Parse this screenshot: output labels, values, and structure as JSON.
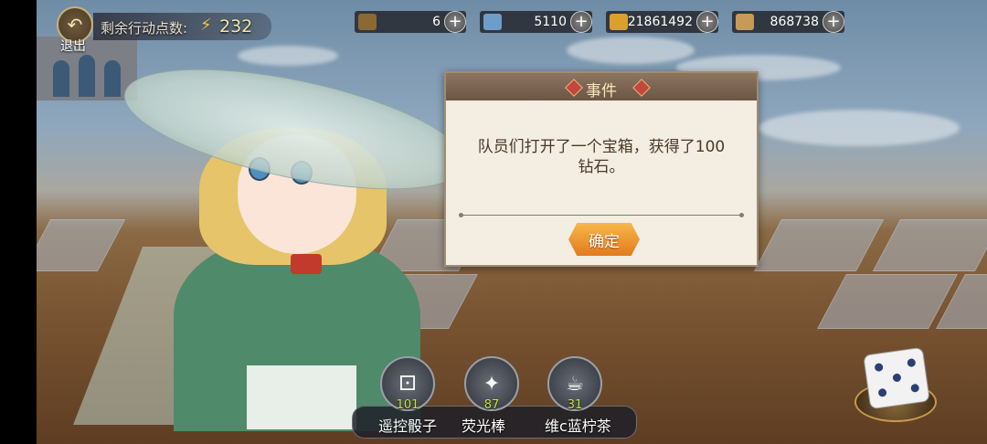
{
  "hud": {
    "exit_label": "退出",
    "action_points_label": "剩余行动点数:",
    "action_points_value": "232"
  },
  "resources": [
    {
      "icon": "treasure-chest-icon",
      "value": "6"
    },
    {
      "icon": "ticket-icon",
      "value": "5110"
    },
    {
      "icon": "gold-coin-icon",
      "value": "21861492"
    },
    {
      "icon": "scroll-icon",
      "value": "868738"
    }
  ],
  "dialog": {
    "title": "事件",
    "message": "队员们打开了一个宝箱，获得了100钻石。",
    "confirm_label": "确定"
  },
  "items": [
    {
      "label": "遥控骰子",
      "count": "101",
      "icon": "dice-card-icon"
    },
    {
      "label": "荧光棒",
      "count": "87",
      "icon": "glow-stick-icon"
    },
    {
      "label": "维c蓝柠茶",
      "count": "31",
      "icon": "tea-bottle-icon"
    }
  ],
  "colors": {
    "accent_orange": "#e27a1e",
    "dialog_bg": "#f3ede2",
    "count_green": "#c9e43a"
  }
}
